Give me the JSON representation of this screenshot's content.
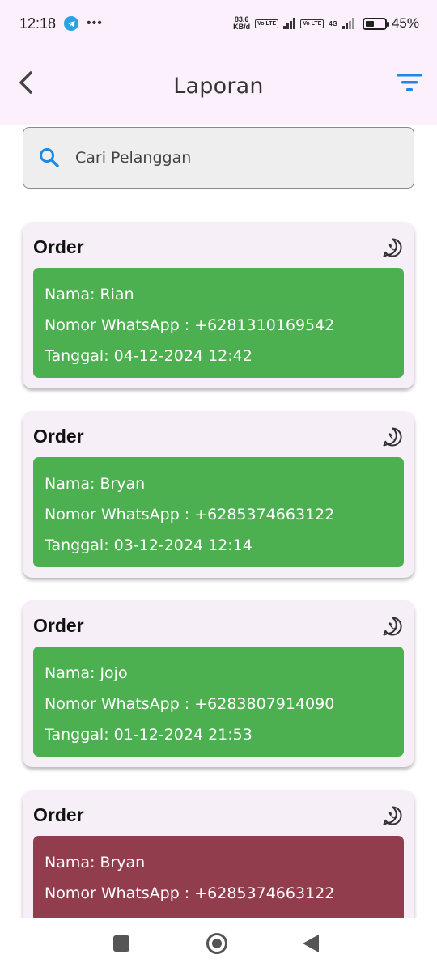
{
  "status_bar": {
    "time": "12:18",
    "speed_value": "83,6",
    "speed_unit": "KB/d",
    "volte1": "Vo LTE",
    "volte2": "Vo LTE",
    "network_type": "4G",
    "battery_percent": "45%",
    "battery_level": 0.45
  },
  "app_bar": {
    "title": "Laporan"
  },
  "search": {
    "placeholder": "Cari Pelanggan"
  },
  "colors": {
    "completed": "#4caf50",
    "pending": "#923d4d",
    "card_bg": "#f6eff7",
    "app_bar_bg": "#fbf0fb",
    "accent": "#1e88e5"
  },
  "orders": [
    {
      "title": "Order",
      "name_line": "Nama: Rian",
      "phone_line": "Nomor WhatsApp : +6281310169542",
      "date_line": "Tanggal: 04-12-2024   12:42",
      "status_color": "#4caf50"
    },
    {
      "title": "Order",
      "name_line": "Nama: Bryan",
      "phone_line": "Nomor WhatsApp : +6285374663122",
      "date_line": "Tanggal: 03-12-2024   12:14",
      "status_color": "#4caf50"
    },
    {
      "title": "Order",
      "name_line": "Nama: Jojo",
      "phone_line": "Nomor WhatsApp : +6283807914090",
      "date_line": "Tanggal: 01-12-2024   21:53",
      "status_color": "#4caf50"
    },
    {
      "title": "Order",
      "name_line": "Nama: Bryan",
      "phone_line": "Nomor WhatsApp : +6285374663122",
      "date_line": "",
      "status_color": "#923d4d"
    }
  ],
  "icons": {
    "back": "arrow-back-icon",
    "filter": "filter-icon",
    "search": "search-icon",
    "whatsapp": "whatsapp-icon"
  }
}
